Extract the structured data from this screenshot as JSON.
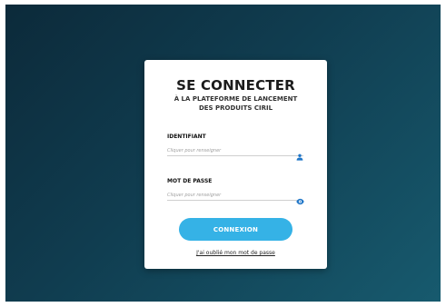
{
  "login": {
    "title": "SE CONNECTER",
    "subtitle_line1": "À LA PLATEFORME DE LANCEMENT",
    "subtitle_line2": "DES PRODUITS CIRIL",
    "identifiant": {
      "label": "IDENTIFIANT",
      "placeholder": "Cliquer pour renseigner",
      "icon": "user-icon"
    },
    "password": {
      "label": "MOT DE PASSE",
      "placeholder": "Cliquer pour renseigner",
      "icon": "eye-icon"
    },
    "submit_label": "CONNEXION",
    "forgot_label": "J'ai oublié mon mot de passe"
  },
  "colors": {
    "background_dark": "#0c2a3a",
    "background_light": "#175a6e",
    "accent": "#35b2e6",
    "icon": "#1f76c8",
    "card": "#ffffff"
  }
}
